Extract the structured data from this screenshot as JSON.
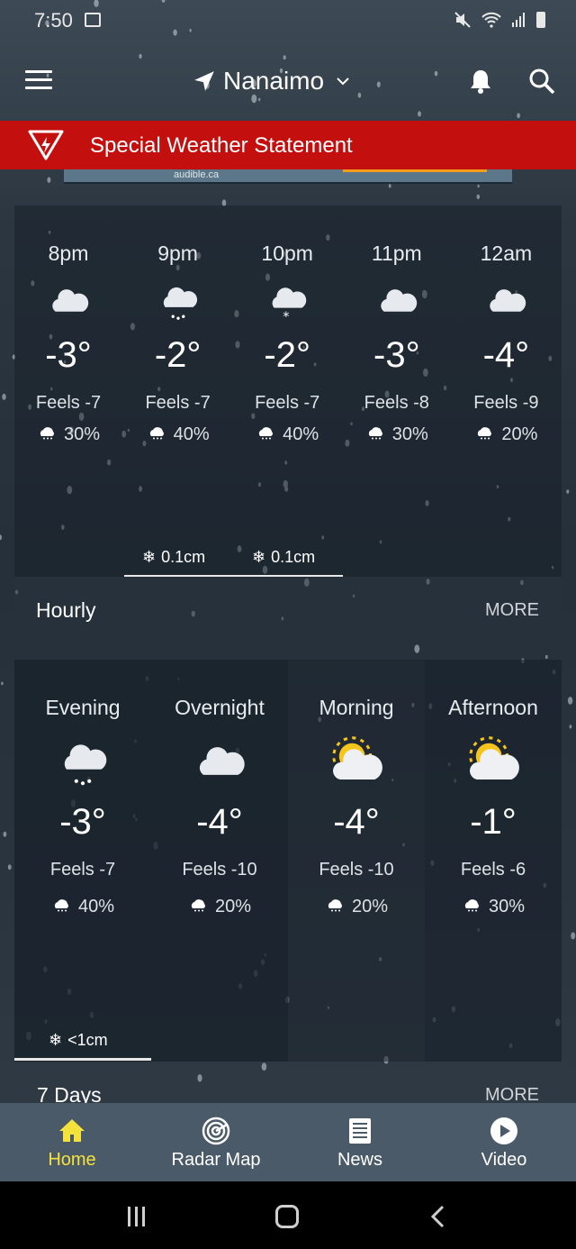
{
  "status_bar": {
    "time": "7:50"
  },
  "header": {
    "location": "Nanaimo"
  },
  "alert": {
    "text": "Special Weather Statement",
    "color": "#c40f0f"
  },
  "ad": {
    "text": "audible.ca"
  },
  "hourly": {
    "items": [
      {
        "time": "8pm",
        "icon": "night-cloudy-icon",
        "temp": "-3°",
        "feels": "Feels -7",
        "pop": "30%"
      },
      {
        "time": "9pm",
        "icon": "snow-cloud-icon",
        "temp": "-2°",
        "feels": "Feels -7",
        "pop": "40%"
      },
      {
        "time": "10pm",
        "icon": "night-snow-icon",
        "temp": "-2°",
        "feels": "Feels -7",
        "pop": "40%"
      },
      {
        "time": "11pm",
        "icon": "night-cloudy-icon",
        "temp": "-3°",
        "feels": "Feels -8",
        "pop": "30%"
      },
      {
        "time": "12am",
        "icon": "night-cloudy-icon",
        "temp": "-4°",
        "feels": "Feels -9",
        "pop": "20%"
      }
    ],
    "accumulations": [
      "0.1cm",
      "0.1cm"
    ],
    "label": "Hourly",
    "more": "MORE"
  },
  "daypart": {
    "items": [
      {
        "time": "Evening",
        "icon": "snow-cloud-icon",
        "temp": "-3°",
        "feels": "Feels -7",
        "pop": "40%"
      },
      {
        "time": "Overnight",
        "icon": "night-cloudy-icon",
        "temp": "-4°",
        "feels": "Feels -10",
        "pop": "20%"
      },
      {
        "time": "Morning",
        "icon": "sun-cloud-icon",
        "temp": "-4°",
        "feels": "Feels -10",
        "pop": "20%"
      },
      {
        "time": "Afternoon",
        "icon": "sun-cloud-icon",
        "temp": "-1°",
        "feels": "Feels -6",
        "pop": "30%"
      }
    ],
    "accumulation": "<1cm"
  },
  "seven_days": {
    "label": "7 Days",
    "more": "MORE"
  },
  "tabs": [
    {
      "label": "Home",
      "icon": "home-icon",
      "active": true
    },
    {
      "label": "Radar Map",
      "icon": "radar-icon",
      "active": false
    },
    {
      "label": "News",
      "icon": "news-icon",
      "active": false
    },
    {
      "label": "Video",
      "icon": "play-icon",
      "active": false
    }
  ],
  "colors": {
    "active_tab": "#f5e23c",
    "tabbar": "#4a5a68"
  }
}
